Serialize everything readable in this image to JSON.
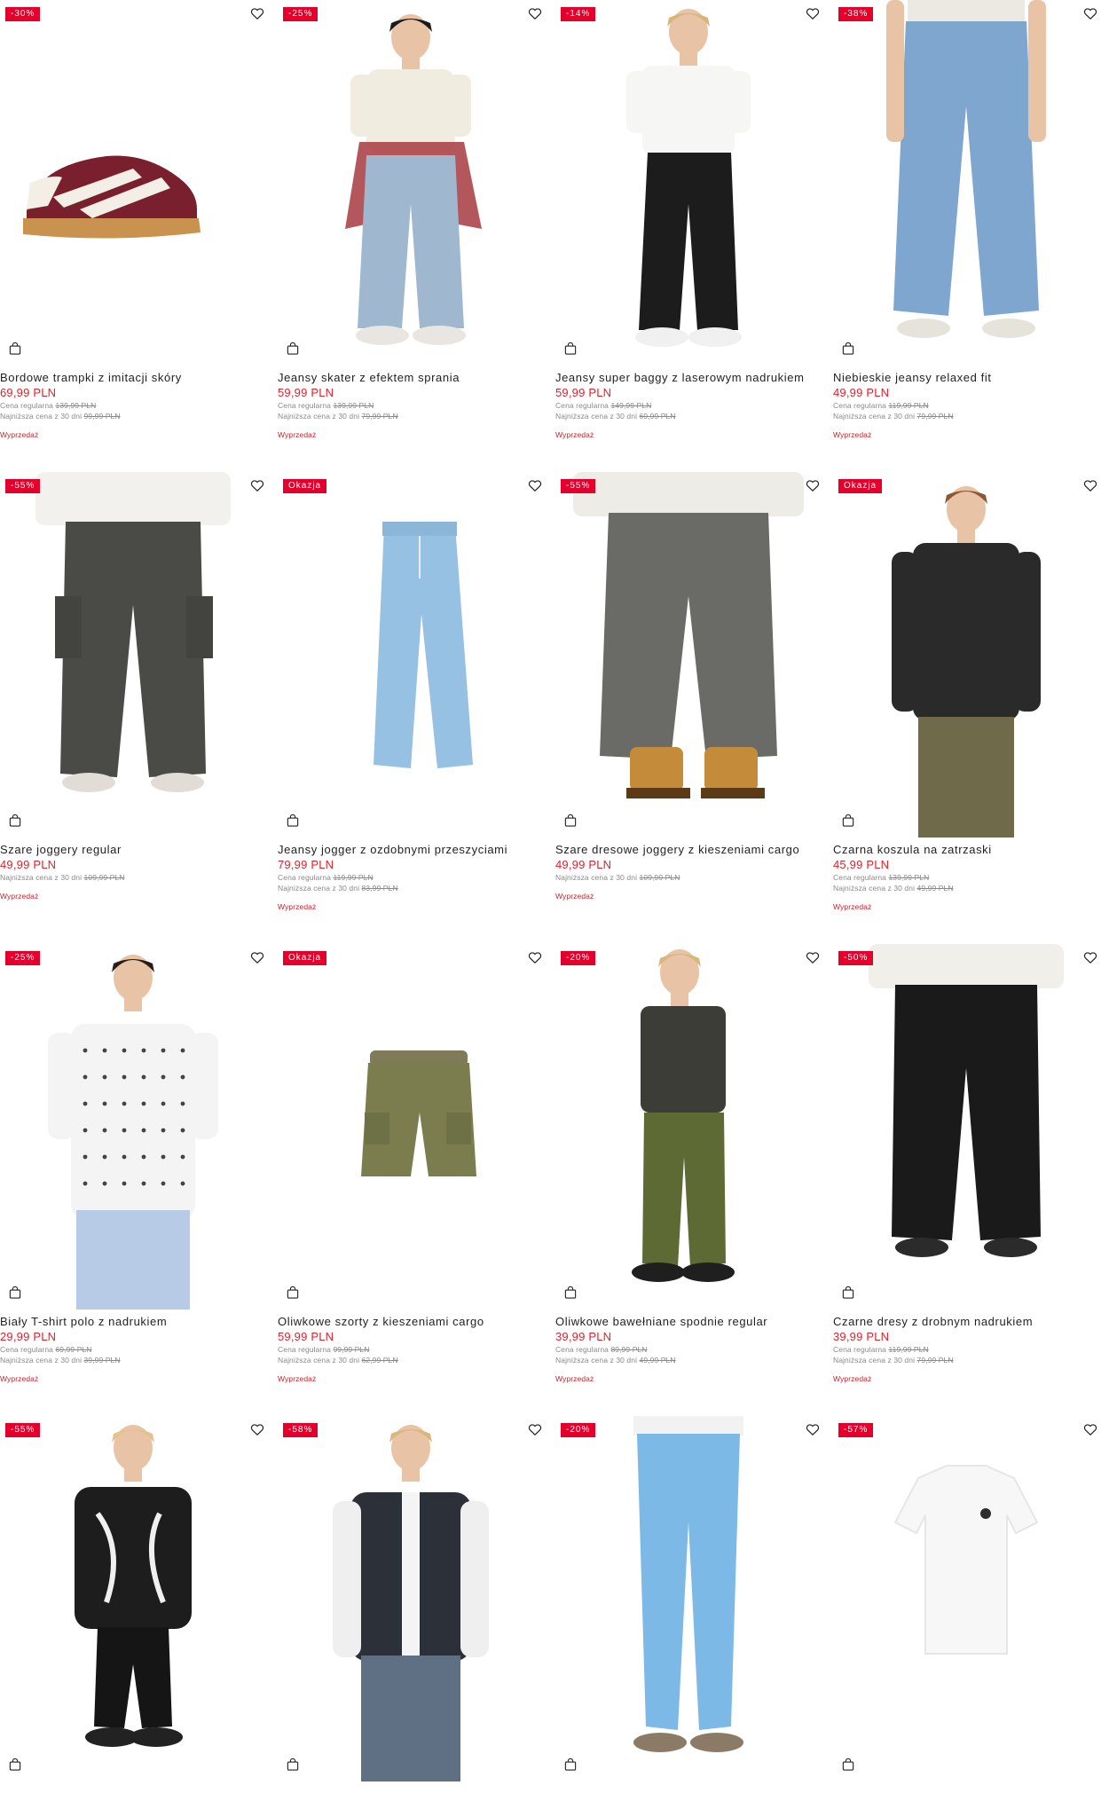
{
  "products": [
    {
      "badge": "-30%",
      "name": "Bordowe trampki z imitacji skóry",
      "price": "69,99 PLN",
      "line1_label": "Cena regularna",
      "line1_value": "139,99 PLN",
      "line2_label": "Najniższa cena z 30 dni",
      "line2_value": "99,99 PLN",
      "tag": "Wyprzedaż",
      "image": "burgundy-sneaker"
    },
    {
      "badge": "-25%",
      "name": "Jeansy skater z efektem sprania",
      "price": "59,99 PLN",
      "line1_label": "Cena regularna",
      "line1_value": "139,99 PLN",
      "line2_label": "Najniższa cena z 30 dni",
      "line2_value": "79,99 PLN",
      "tag": "Wyprzedaż",
      "image": "model-skater-jeans"
    },
    {
      "badge": "-14%",
      "name": "Jeansy super baggy z laserowym nadrukiem",
      "price": "59,99 PLN",
      "line1_label": "Cena regularna",
      "line1_value": "149,99 PLN",
      "line2_label": "Najniższa cena z 30 dni",
      "line2_value": "69,99 PLN",
      "tag": "Wyprzedaż",
      "image": "model-black-baggy-jeans"
    },
    {
      "badge": "-38%",
      "name": "Niebieskie jeansy relaxed fit",
      "price": "49,99 PLN",
      "line1_label": "Cena regularna",
      "line1_value": "119,99 PLN",
      "line2_label": "Najniższa cena z 30 dni",
      "line2_value": "79,99 PLN",
      "tag": "Wyprzedaż",
      "image": "blue-relaxed-jeans"
    },
    {
      "badge": "-55%",
      "name": "Szare joggery regular",
      "price": "49,99 PLN",
      "line1_label": "Najniższa cena z 30 dni",
      "line1_value": "109,99 PLN",
      "line2_label": "",
      "line2_value": "",
      "tag": "Wyprzedaż",
      "image": "grey-cargo-joggers"
    },
    {
      "badge": "Okazja",
      "name": "Jeansy jogger z ozdobnymi przeszyciami",
      "price": "79,99 PLN",
      "line1_label": "Cena regularna",
      "line1_value": "119,99 PLN",
      "line2_label": "Najniższa cena z 30 dni",
      "line2_value": "83,99 PLN",
      "tag": "Wyprzedaż",
      "image": "denim-jogger-packshot"
    },
    {
      "badge": "-55%",
      "name": "Szare dresowe joggery z kieszeniami cargo",
      "price": "49,99 PLN",
      "line1_label": "Najniższa cena z 30 dni",
      "line1_value": "109,99 PLN",
      "line2_label": "",
      "line2_value": "",
      "tag": "Wyprzedaż",
      "image": "grey-sweat-joggers-boots"
    },
    {
      "badge": "Okazja",
      "name": "Czarna koszula na zatrzaski",
      "price": "45,99 PLN",
      "line1_label": "Cena regularna",
      "line1_value": "139,99 PLN",
      "line2_label": "Najniższa cena z 30 dni",
      "line2_value": "49,99 PLN",
      "tag": "Wyprzedaż",
      "image": "model-black-shirt"
    },
    {
      "badge": "-25%",
      "name": "Biały T-shirt polo z nadrukiem",
      "price": "29,99 PLN",
      "line1_label": "Cena regularna",
      "line1_value": "69,99 PLN",
      "line2_label": "Najniższa cena z 30 dni",
      "line2_value": "39,99 PLN",
      "tag": "Wyprzedaż",
      "image": "model-white-polo"
    },
    {
      "badge": "Okazja",
      "name": "Oliwkowe szorty z kieszeniami cargo",
      "price": "59,99 PLN",
      "line1_label": "Cena regularna",
      "line1_value": "99,99 PLN",
      "line2_label": "Najniższa cena z 30 dni",
      "line2_value": "62,99 PLN",
      "tag": "Wyprzedaż",
      "image": "olive-cargo-shorts"
    },
    {
      "badge": "-20%",
      "name": "Oliwkowe bawełniane spodnie regular",
      "price": "39,99 PLN",
      "line1_label": "Cena regularna",
      "line1_value": "89,99 PLN",
      "line2_label": "Najniższa cena z 30 dni",
      "line2_value": "49,99 PLN",
      "tag": "Wyprzedaż",
      "image": "model-olive-trousers"
    },
    {
      "badge": "-50%",
      "name": "Czarne dresy z drobnym nadrukiem",
      "price": "39,99 PLN",
      "line1_label": "Cena regularna",
      "line1_value": "119,99 PLN",
      "line2_label": "Najniższa cena z 30 dni",
      "line2_value": "79,99 PLN",
      "tag": "Wyprzedaż",
      "image": "black-track-pants"
    },
    {
      "badge": "-55%",
      "name": "",
      "price": "",
      "line1_label": "",
      "line1_value": "",
      "line2_label": "",
      "line2_value": "",
      "tag": "",
      "image": "model-black-fleece-jacket"
    },
    {
      "badge": "-58%",
      "name": "",
      "price": "",
      "line1_label": "",
      "line1_value": "",
      "line2_label": "",
      "line2_value": "",
      "tag": "",
      "image": "model-varsity-jacket"
    },
    {
      "badge": "-20%",
      "name": "",
      "price": "",
      "line1_label": "",
      "line1_value": "",
      "line2_label": "",
      "line2_value": "",
      "tag": "",
      "image": "light-blue-skinny-jeans"
    },
    {
      "badge": "-57%",
      "name": "",
      "price": "",
      "line1_label": "",
      "line1_value": "",
      "line2_label": "",
      "line2_value": "",
      "tag": "",
      "image": "white-polo-packshot"
    }
  ],
  "icons": {
    "wishlist": "heart-outline-icon",
    "add_to_cart": "shopping-bag-icon"
  },
  "colors": {
    "badge": "#e4002b",
    "price": "#e4202b",
    "sale_tag": "#d2202a"
  }
}
